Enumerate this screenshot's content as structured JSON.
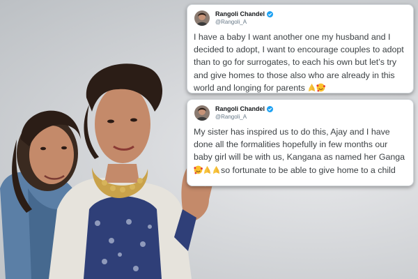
{
  "tweets": [
    {
      "name": "Rangoli Chandel",
      "handle": "@Rangoli_A",
      "text": "I have a baby I want another one my husband and I decided to adopt, I want to encourage couples to adopt than to go for surrogates, to each his own but let’s try and give homes to those also who are already in this world and longing for parents",
      "emojis": [
        "folded-hands",
        "smiling-face-with-hearts"
      ]
    },
    {
      "name": "Rangoli Chandel",
      "handle": "@Rangoli_A",
      "text_before": "My sister has inspired us to do this, Ajay and I have done all the formalities hopefully in few months our baby girl will be with us, Kangana as named her Ganga",
      "text_after": "so fortunate to be able to give home to a child",
      "emojis": [
        "smiling-face-with-hearts",
        "folded-hands",
        "folded-hands"
      ]
    }
  ],
  "colors": {
    "verified": "#1da1f2",
    "text": "#3c4144",
    "handle": "#657786"
  }
}
